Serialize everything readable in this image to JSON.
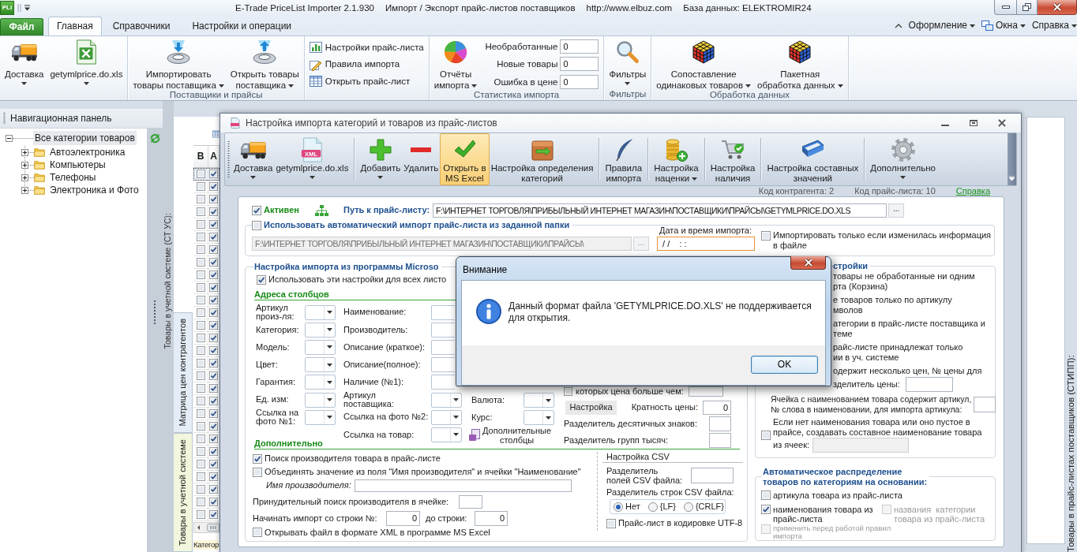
{
  "window": {
    "app_icon": "PLi",
    "title_segments": [
      "E-Trade PriceList Importer 2.1.930",
      "Импорт / Экспорт прайс-листов поставщиков",
      "http://www.elbuz.com",
      "База данных: ELEKTROMIR24"
    ]
  },
  "ribbon": {
    "file_button": "Файл",
    "tabs": [
      {
        "label": "Главная",
        "selected": true
      },
      {
        "label": "Справочники",
        "selected": false
      },
      {
        "label": "Настройки и операции",
        "selected": false
      }
    ],
    "menus": [
      {
        "label": "Оформление"
      },
      {
        "label": "Окна"
      },
      {
        "label": "Справка"
      }
    ],
    "groups": [
      {
        "items": [
          {
            "kind": "large",
            "lines": [
              "Доставка"
            ],
            "dropdown": true
          },
          {
            "kind": "large",
            "lines": [
              "getymlprice.do.xls"
            ],
            "dropdown": true
          }
        ]
      },
      {
        "label": "Поставщики и прайсы",
        "items": [
          {
            "kind": "large",
            "lines": [
              "Импортировать",
              "товары поставщика"
            ],
            "dropdown": true
          },
          {
            "kind": "large",
            "lines": [
              "Открыть товары",
              "поставщика"
            ],
            "dropdown": true
          }
        ]
      },
      {
        "items": [
          {
            "kind": "small",
            "label": "Настройки прайс-листа"
          },
          {
            "kind": "small",
            "label": "Правила импорта"
          },
          {
            "kind": "small",
            "label": "Открыть прайс-лист"
          }
        ]
      },
      {
        "label": "Статистика импорта",
        "items": [
          {
            "kind": "large",
            "lines": [
              "Отчёты",
              "импорта"
            ],
            "dropdown": true
          },
          {
            "kind": "stats",
            "rows": [
              {
                "label": "Необработанные",
                "value": "0"
              },
              {
                "label": "Новые товары",
                "value": "0"
              },
              {
                "label": "Ошибка в цене",
                "value": "0"
              }
            ]
          }
        ]
      },
      {
        "label": "Фильтры",
        "items": [
          {
            "kind": "large",
            "lines": [
              "Фильтры"
            ],
            "dropdown": true
          }
        ]
      },
      {
        "label": "Обработка данных",
        "items": [
          {
            "kind": "large",
            "lines": [
              "Сопоставление",
              "одинаковых товаров"
            ],
            "dropdown": true
          },
          {
            "kind": "large",
            "lines": [
              "Пакетная",
              "обработка данных"
            ],
            "dropdown": true
          }
        ]
      }
    ]
  },
  "nav_panel": {
    "title": "Навигационная панель",
    "tree": [
      {
        "label": "Все категории товаров",
        "expanded": true,
        "selected": true,
        "children": [
          {
            "label": "Автоэлектроника",
            "expanded": false,
            "selected": false
          },
          {
            "label": "Компьютеры",
            "expanded": false,
            "selected": false
          },
          {
            "label": "Телефоны",
            "expanded": false,
            "selected": false
          },
          {
            "label": "Электроника и Фото",
            "expanded": false,
            "selected": false
          }
        ]
      }
    ]
  },
  "accounting_panel": {
    "caption": "Товары в учетной системе (СТ УС):",
    "tabs": [
      {
        "label": "Матрица цен контрагентов",
        "selected": false
      },
      {
        "label": "Товары в учетной системе",
        "selected": true
      }
    ],
    "grid": {
      "columns": [
        "В",
        "А"
      ],
      "rows": [
        {
          "selected": true,
          "cells": [
            {
              "checked": false
            },
            {
              "checked": true
            }
          ]
        },
        {
          "selected": false,
          "cells": [
            {
              "checked": false
            },
            {
              "checked": true
            }
          ]
        },
        {
          "selected": false,
          "cells": [
            {
              "checked": false
            },
            {
              "checked": true
            }
          ]
        },
        {
          "selected": false,
          "cells": [
            {
              "checked": false
            },
            {
              "checked": true
            }
          ]
        },
        {
          "selected": false,
          "cells": [
            {
              "checked": false
            },
            {
              "checked": true
            }
          ]
        },
        {
          "selected": false,
          "cells": [
            {
              "checked": false
            },
            {
              "checked": true
            }
          ]
        },
        {
          "selected": false,
          "cells": [
            {
              "checked": false
            },
            {
              "checked": true
            }
          ]
        },
        {
          "selected": false,
          "cells": [
            {
              "checked": false
            },
            {
              "checked": true
            }
          ]
        },
        {
          "selected": false,
          "cells": [
            {
              "checked": false
            },
            {
              "checked": true
            }
          ]
        },
        {
          "selected": false,
          "cells": [
            {
              "checked": false
            },
            {
              "checked": true
            }
          ]
        },
        {
          "selected": false,
          "cells": [
            {
              "checked": false
            },
            {
              "checked": true
            }
          ]
        },
        {
          "selected": false,
          "cells": [
            {
              "checked": false
            },
            {
              "checked": true
            }
          ]
        },
        {
          "selected": false,
          "cells": [
            {
              "checked": false
            },
            {
              "checked": true
            }
          ]
        },
        {
          "selected": false,
          "cells": [
            {
              "checked": false
            },
            {
              "checked": true
            }
          ]
        },
        {
          "selected": false,
          "cells": [
            {
              "checked": false
            },
            {
              "checked": true
            }
          ]
        },
        {
          "selected": false,
          "cells": [
            {
              "checked": false
            },
            {
              "checked": true
            }
          ]
        },
        {
          "selected": false,
          "cells": [
            {
              "checked": false
            },
            {
              "checked": true
            }
          ]
        },
        {
          "selected": false,
          "cells": [
            {
              "checked": false
            },
            {
              "checked": true
            }
          ]
        },
        {
          "selected": false,
          "cells": [
            {
              "checked": false
            },
            {
              "checked": true
            }
          ]
        },
        {
          "selected": false,
          "cells": [
            {
              "checked": false
            },
            {
              "checked": true
            }
          ]
        },
        {
          "selected": false,
          "cells": [
            {
              "checked": false
            },
            {
              "checked": true
            }
          ]
        },
        {
          "selected": false,
          "cells": [
            {
              "checked": false
            },
            {
              "checked": true
            }
          ]
        },
        {
          "selected": false,
          "cells": [
            {
              "checked": false
            },
            {
              "checked": true
            }
          ]
        },
        {
          "selected": false,
          "cells": [
            {
              "checked": false
            },
            {
              "checked": true
            }
          ]
        },
        {
          "selected": false,
          "cells": [
            {
              "checked": false
            },
            {
              "checked": true
            }
          ]
        },
        {
          "selected": false,
          "cells": [
            {
              "checked": false
            },
            {
              "checked": true
            }
          ]
        },
        {
          "selected": false,
          "cells": [
            {
              "checked": false
            },
            {
              "checked": true
            }
          ]
        },
        {
          "selected": false,
          "cells": [
            {
              "checked": false
            },
            {
              "checked": true
            }
          ]
        }
      ]
    },
    "bottom_label": "Категор"
  },
  "supplier_panel": {
    "caption": "Товары в прайс-листах поставщиков (СТИПП):"
  },
  "import_dialog": {
    "title": "Настройка импорта категорий и товаров из прайс-листов",
    "toolbar": [
      {
        "lines": [
          "Доставка"
        ],
        "dropdown": true,
        "pressed": false,
        "separator_before": false
      },
      {
        "icon_text": "XML",
        "lines": [
          "getymlprice.do.xls"
        ],
        "dropdown": true,
        "pressed": false,
        "separator_before": false
      },
      {
        "lines": [
          "Добавить"
        ],
        "dropdown": true,
        "pressed": false,
        "separator_before": true
      },
      {
        "lines": [
          "Удалить"
        ],
        "dropdown": false,
        "pressed": false,
        "separator_before": false
      },
      {
        "lines": [
          "Открыть в",
          "MS Excel"
        ],
        "dropdown": false,
        "pressed": true,
        "separator_before": false
      },
      {
        "lines": [
          "Настройка определения",
          "категорий"
        ],
        "dropdown": false,
        "pressed": false,
        "separator_before": false
      },
      {
        "lines": [
          "Правила",
          "импорта"
        ],
        "dropdown": false,
        "pressed": false,
        "separator_before": true
      },
      {
        "lines": [
          "Настройка",
          "наценки"
        ],
        "dropdown": true,
        "pressed": false,
        "separator_before": true
      },
      {
        "lines": [
          "Настройка",
          "наличия"
        ],
        "dropdown": false,
        "pressed": false,
        "separator_before": true
      },
      {
        "lines": [
          "Настройка составных",
          "значений"
        ],
        "dropdown": false,
        "pressed": false,
        "separator_before": true
      },
      {
        "lines": [
          "Дополнительно"
        ],
        "dropdown": true,
        "pressed": false,
        "separator_before": true
      }
    ],
    "codes": [
      "Код контрагента: 2",
      "Код прайс-листа: 10"
    ],
    "help_link": "Справка",
    "active": {
      "label": "Активен",
      "checked": true
    },
    "path": {
      "label": "Путь к прайс-листу:",
      "value": "F:\\ИНТЕРНЕТ ТОРГОВЛЯ\\ПРИБЫЛЬНЫЙ ИНТЕРНЕТ МАГАЗИН\\ПОСТАВЩИКИ\\ПРАЙСЫ\\GETYMLPRICE.DO.XLS",
      "browse": "..."
    },
    "auto_import": {
      "label": "Использовать автоматический импорт прайс-листа из заданной папки",
      "checked": false,
      "folder": "F:\\ИНТЕРНЕТ ТОРГОВЛЯ\\ПРИБЫЛЬНЫЙ ИНТЕРНЕТ МАГАЗИН\\ПОСТАВЩИКИ\\ПРАЙСЫ\\",
      "browse": "...",
      "date_label": "Дата и время импорта:",
      "date_value": " / /    : :",
      "only_if_changed": {
        "label": "Импортировать только если изменилась информация в файле",
        "checked": false
      }
    },
    "excel_settings": {
      "legend": "Настройка импорта из программы Microso",
      "all_sheets": {
        "label": "Использовать эти настройки для всех листо",
        "checked": true
      },
      "columns_heading": "Адреса столбцов",
      "column_groups": [
        [
          {
            "lines": [
              "Артикул",
              "произ-ля:"
            ]
          },
          {
            "lines": [
              "Категория:"
            ]
          },
          {
            "lines": [
              "Модель:"
            ]
          },
          {
            "lines": [
              "Цвет:"
            ]
          },
          {
            "lines": [
              "Гарантия:"
            ]
          },
          {
            "lines": [
              "Ед. изм:"
            ]
          },
          {
            "lines": [
              "Ссылка на",
              "фото №1:"
            ]
          }
        ],
        [
          {
            "lines": [
              "Наименование:"
            ]
          },
          {
            "lines": [
              "Производитель:"
            ]
          },
          {
            "lines": [
              "Описание (краткое):"
            ]
          },
          {
            "lines": [
              "Описание(полное):"
            ]
          },
          {
            "lines": [
              "Наличие (№1):"
            ]
          },
          {
            "lines": [
              "Артикул",
              "поставщика:"
            ]
          },
          {
            "lines": [
              "Ссылка на фото №2:"
            ]
          },
          {
            "lines": [
              "Ссылка на товар:"
            ]
          }
        ],
        [
          {
            "lines": [
              "Валюта:"
            ]
          },
          {
            "lines": [
              "Курс:"
            ]
          }
        ]
      ],
      "extra_columns": [
        "Дополнительные",
        "столбцы"
      ],
      "price_options": {
        "above_price": {
          "label": "которых цена больше чем:",
          "checked": false
        },
        "setup_button": "Настройка",
        "multiplicity_label": "Кратность цены:",
        "multiplicity": "0",
        "decimal_separator_label": "Разделитель десятичных знаков:",
        "thousands_separator_label": "Разделитель групп тысяч:"
      },
      "additional": {
        "heading": "Дополнительно",
        "find_manufacturer": {
          "label": "Поиск производителя товара в прайс-листе",
          "checked": true
        },
        "merge_name": {
          "label": "Объединять значение из поля \"Имя производителя\" и ячейки \"Наименование\"",
          "checked": false
        },
        "manufacturer_name_label": "Имя производителя:",
        "forced_search_label": "Принудительный поиск производителя в ячейке:",
        "start_row_label": "Начинать импорт со строки №:",
        "start_row": "0",
        "end_row_label": "до строки:",
        "end_row": "0",
        "open_xml": {
          "label": "Открывать файл в формате XML в программе MS Excel",
          "checked": false
        }
      },
      "csv": {
        "heading": "Настройка CSV",
        "field_separator_label": [
          "Разделитель",
          "полей CSV файла:"
        ],
        "row_separator_label": "Разделитель строк CSV файла:",
        "row_separators": [
          {
            "label": "Нет",
            "selected": true
          },
          {
            "label": "{LF}",
            "selected": false
          },
          {
            "label": "{CRLF}",
            "selected": false
          }
        ],
        "utf8": {
          "label": "Прайс-лист в кодировке UTF-8",
          "checked": false
        }
      }
    },
    "other_settings": {
      "legend": "стройки",
      "partial_lines": [
        [
          "товары не обработанные ни одним",
          "рта (Корзина)"
        ],
        [
          "е товаров только по артикулу",
          "мволов"
        ],
        [
          "атегории в прайс-листе поставщика и",
          "теме"
        ],
        [
          "райс-листе принадлежат только",
          "ии в уч. системе"
        ],
        [
          "одержит несколько цен, № цены для",
          "зделитель цены:"
        ]
      ],
      "article_in_name": [
        "Ячейка с наименованием товара содержит артикул,",
        "№ слова в наименовании, для импорта артикула:"
      ],
      "compose_name": {
        "lines": [
          "Если нет наименования товара или оно пустое в",
          "прайсе, создавать составное наименование товара",
          "из ячеек:"
        ],
        "checked": false
      }
    },
    "auto_distribution": {
      "legend": [
        "Автоматическое распределение",
        "товаров по категориям на основании:"
      ],
      "options": [
        {
          "lines": [
            "артикула товара из прайс-листа"
          ],
          "checked": false,
          "disabled": false
        },
        {
          "lines": [
            "наименования товара из",
            "прайс-листа"
          ],
          "checked": true,
          "disabled": false
        },
        {
          "lines": [
            "названия  категории",
            "товара из прайс-листа"
          ],
          "checked": false,
          "disabled": true
        },
        {
          "lines": [
            "применить перед работой правил",
            "импорта"
          ],
          "checked": false,
          "disabled": true
        }
      ]
    }
  },
  "message_box": {
    "title": "Внимание",
    "lines": [
      "Данный формат файла 'GETYMLPRICE.DO.XLS' не поддерживается",
      "для открытия."
    ],
    "button": "OK"
  }
}
